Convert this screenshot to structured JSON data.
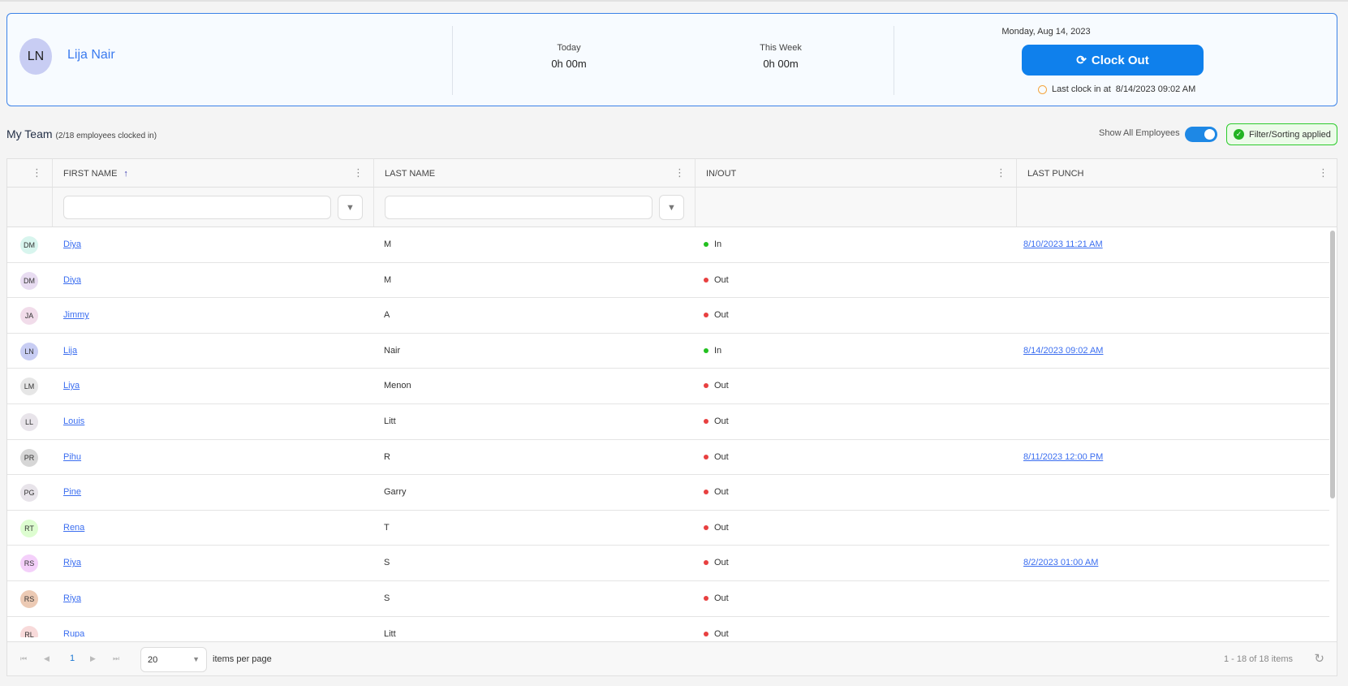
{
  "user": {
    "initials": "LN",
    "name": "Lija Nair"
  },
  "stats": {
    "today_label": "Today",
    "today_value": "0h 00m",
    "week_label": "This Week",
    "week_value": "0h 00m"
  },
  "clock": {
    "date": "Monday, Aug 14, 2023",
    "button": "Clock Out",
    "last_label": "Last clock in at",
    "last_value": "8/14/2023 09:02 AM"
  },
  "team": {
    "title": "My Team",
    "subtitle": "(2/18 employees clocked in)",
    "show_all": "Show All Employees",
    "show_all_on": true,
    "filter_badge": "Filter/Sorting applied"
  },
  "columns": {
    "first": "FIRST NAME",
    "last": "LAST NAME",
    "inout": "IN/OUT",
    "punch": "LAST PUNCH"
  },
  "colors": {
    "in": "#22c01f",
    "out": "#e84040",
    "accent": "#0f80ec"
  },
  "rows": [
    {
      "initials": "DM",
      "bg": "#d8f5ee",
      "first": "Diya",
      "last": "M",
      "status": "In",
      "punch": "8/10/2023 11:21 AM"
    },
    {
      "initials": "DM",
      "bg": "#e8dcf1",
      "first": "Diya",
      "last": "M",
      "status": "Out",
      "punch": ""
    },
    {
      "initials": "JA",
      "bg": "#f1dcea",
      "first": "Jimmy",
      "last": "A",
      "status": "Out",
      "punch": ""
    },
    {
      "initials": "LN",
      "bg": "#c8cdf3",
      "first": "Lija",
      "last": "Nair",
      "status": "In",
      "punch": "8/14/2023 09:02 AM"
    },
    {
      "initials": "LM",
      "bg": "#e6e6e6",
      "first": "Liya",
      "last": "Menon",
      "status": "Out",
      "punch": ""
    },
    {
      "initials": "LL",
      "bg": "#e8e4ea",
      "first": "Louis",
      "last": "Litt",
      "status": "Out",
      "punch": ""
    },
    {
      "initials": "PR",
      "bg": "#d6d6d6",
      "first": "Pihu",
      "last": "R",
      "status": "Out",
      "punch": "8/11/2023 12:00 PM"
    },
    {
      "initials": "PG",
      "bg": "#e8e4ea",
      "first": "Pine",
      "last": "Garry",
      "status": "Out",
      "punch": ""
    },
    {
      "initials": "RT",
      "bg": "#ddfdd0",
      "first": "Rena",
      "last": "T",
      "status": "Out",
      "punch": ""
    },
    {
      "initials": "RS",
      "bg": "#f4d0fa",
      "first": "Riya",
      "last": "S",
      "status": "Out",
      "punch": "8/2/2023 01:00 AM"
    },
    {
      "initials": "RS",
      "bg": "#eccab4",
      "first": "Riya",
      "last": "S",
      "status": "Out",
      "punch": ""
    },
    {
      "initials": "RL",
      "bg": "#f8dada",
      "first": "Rupa",
      "last": "Litt",
      "status": "Out",
      "punch": ""
    }
  ],
  "pager": {
    "page": "1",
    "page_size": "20",
    "items_per_page": "items per page",
    "count": "1 - 18 of 18 items"
  }
}
